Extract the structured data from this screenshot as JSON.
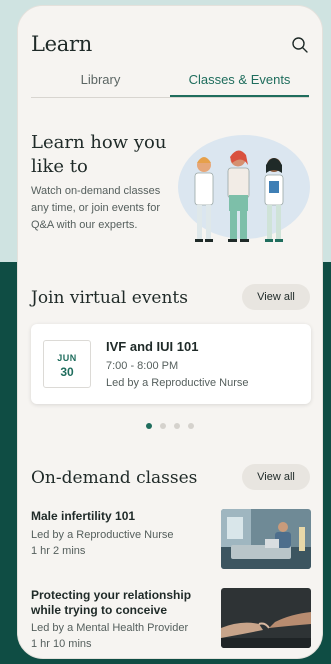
{
  "header": {
    "title": "Learn",
    "search_icon": "search-icon"
  },
  "tabs": [
    {
      "label": "Library",
      "active": false
    },
    {
      "label": "Classes & Events",
      "active": true
    }
  ],
  "hero": {
    "heading": "Learn how you like to",
    "subtext": "Watch on-demand classes any time, or join events for Q&A with our experts."
  },
  "events": {
    "title": "Join virtual events",
    "view_all": "View all",
    "card": {
      "month": "JUN",
      "day": "30",
      "title": "IVF and IUI 101",
      "time": "7:00 - 8:00 PM",
      "led_by": "Led by a Reproductive Nurse"
    },
    "carousel_pages": 4,
    "carousel_active": 1
  },
  "classes": {
    "title": "On-demand classes",
    "view_all": "View all",
    "items": [
      {
        "title": "Male infertility 101",
        "led_by": "Led by a Reproductive Nurse",
        "duration": "1 hr 2 mins"
      },
      {
        "title": "Protecting your relationship while trying to conceive",
        "led_by": "Led by a Mental Health Provider",
        "duration": "1 hr 10 mins"
      }
    ]
  },
  "colors": {
    "accent": "#1f6d5d",
    "dark_bg": "#0f4d44",
    "light_bg": "#cfe3e1",
    "card_bg": "#f6f4f1"
  }
}
